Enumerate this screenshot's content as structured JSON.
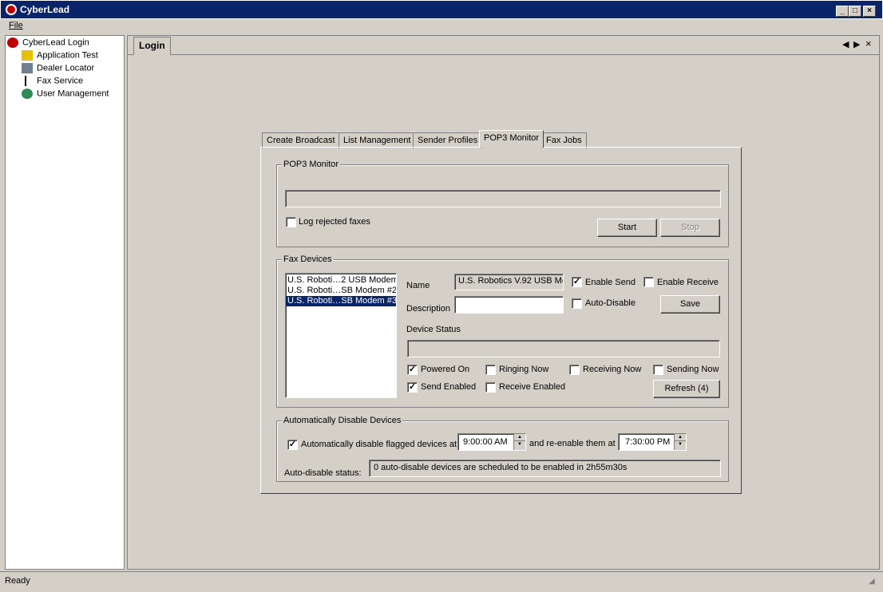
{
  "window": {
    "title": "CyberLead"
  },
  "menu": {
    "file": "File"
  },
  "tree": {
    "root": "CyberLead Login",
    "items": [
      "Application Test",
      "Dealer Locator",
      "Fax Service",
      "User Management"
    ]
  },
  "pane": {
    "tab": "Login"
  },
  "tabs": [
    "Create Broadcast",
    "List Management",
    "Sender Profiles",
    "POP3 Monitor",
    "Fax Jobs"
  ],
  "pop3": {
    "legend": "POP3 Monitor",
    "status_value": "",
    "log_rejected": "Log rejected faxes",
    "start": "Start",
    "stop": "Stop"
  },
  "fax_devices": {
    "legend": "Fax Devices",
    "list": [
      "U.S. Roboti…2 USB Modem",
      "U.S. Roboti…SB Modem #2",
      "U.S. Roboti…SB Modem #3"
    ],
    "name_label": "Name",
    "name_value": "U.S. Robotics V.92 USB Mc",
    "description_label": "Description",
    "description_value": "",
    "enable_send": "Enable Send",
    "enable_receive": "Enable Receive",
    "auto_disable": "Auto-Disable",
    "save": "Save",
    "device_status_label": "Device Status",
    "device_status_value": "",
    "powered_on": "Powered On",
    "ringing_now": "Ringing Now",
    "receiving_now": "Receiving Now",
    "sending_now": "Sending Now",
    "send_enabled": "Send Enabled",
    "receive_enabled": "Receive Enabled",
    "refresh": "Refresh (4)"
  },
  "auto_disable": {
    "legend": "Automatically Disable Devices",
    "checkbox_label": "Automatically disable flagged devices at",
    "start_time": "9:00:00 AM",
    "mid_label": "and re-enable them at",
    "end_time": "7:30:00 PM",
    "status_label": "Auto-disable status:",
    "status_value": "0 auto-disable devices are scheduled to be enabled in 2h55m30s"
  },
  "status_bar": {
    "text": "Ready"
  },
  "checked": "✓"
}
